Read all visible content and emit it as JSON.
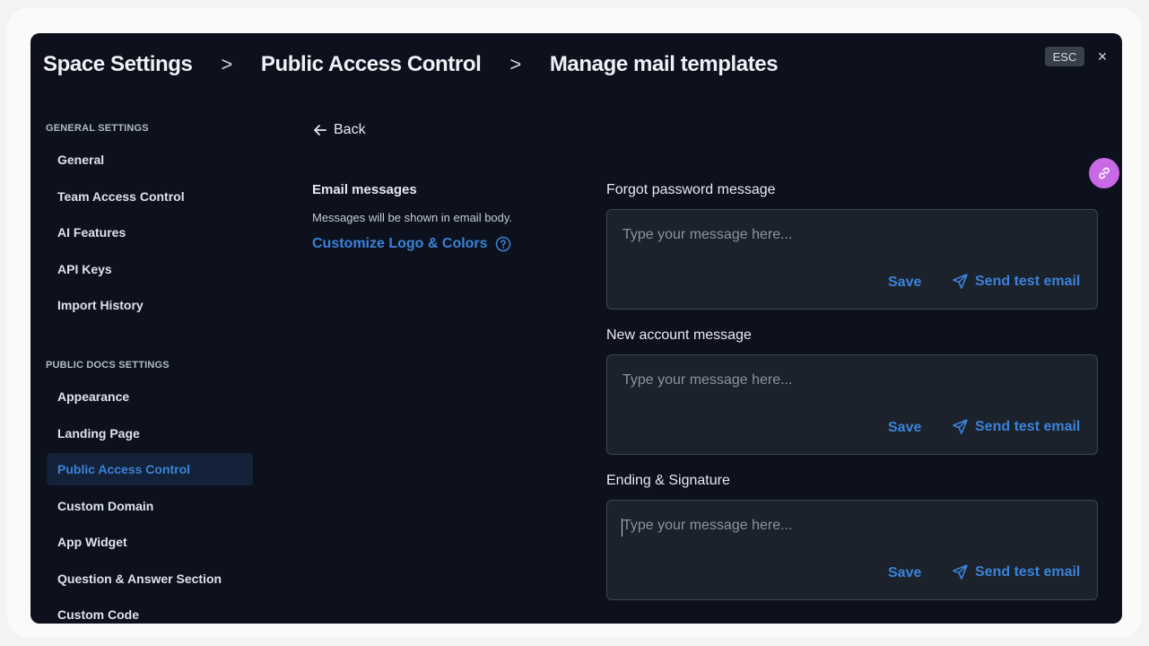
{
  "breadcrumb": {
    "items": [
      "Space Settings",
      "Public Access Control",
      "Manage mail templates"
    ],
    "separator": ">"
  },
  "window_controls": {
    "esc_label": "ESC",
    "close_glyph": "×"
  },
  "sidebar": {
    "sections": [
      {
        "title": "GENERAL SETTINGS",
        "items": [
          "General",
          "Team Access Control",
          "AI Features",
          "API Keys",
          "Import History"
        ]
      },
      {
        "title": "PUBLIC DOCS SETTINGS",
        "items": [
          "Appearance",
          "Landing Page",
          "Public Access Control",
          "Custom Domain",
          "App Widget",
          "Question & Answer Section",
          "Custom Code"
        ]
      }
    ],
    "active_item": "Public Access Control"
  },
  "main": {
    "back_label": "Back",
    "email_title": "Email messages",
    "email_desc": "Messages will be shown in email body.",
    "customize_label": "Customize Logo & Colors",
    "fields": [
      {
        "label": "Forgot password message",
        "placeholder": "Type your message here...",
        "save": "Save",
        "send": "Send test email"
      },
      {
        "label": "New account message",
        "placeholder": "Type your message here...",
        "save": "Save",
        "send": "Send test email"
      },
      {
        "label": "Ending & Signature",
        "placeholder": "Type your message here...",
        "save": "Save",
        "send": "Send test email"
      }
    ]
  },
  "icons": {
    "back": "arrow-left-icon",
    "help": "question-circle-icon",
    "send": "paper-plane-icon",
    "fab": "link-icon"
  },
  "colors": {
    "background": "#0c111d",
    "accent": "#3b82d8",
    "active_bg": "#132238",
    "fab": "#c869e6",
    "input_bg": "#1c222c"
  }
}
